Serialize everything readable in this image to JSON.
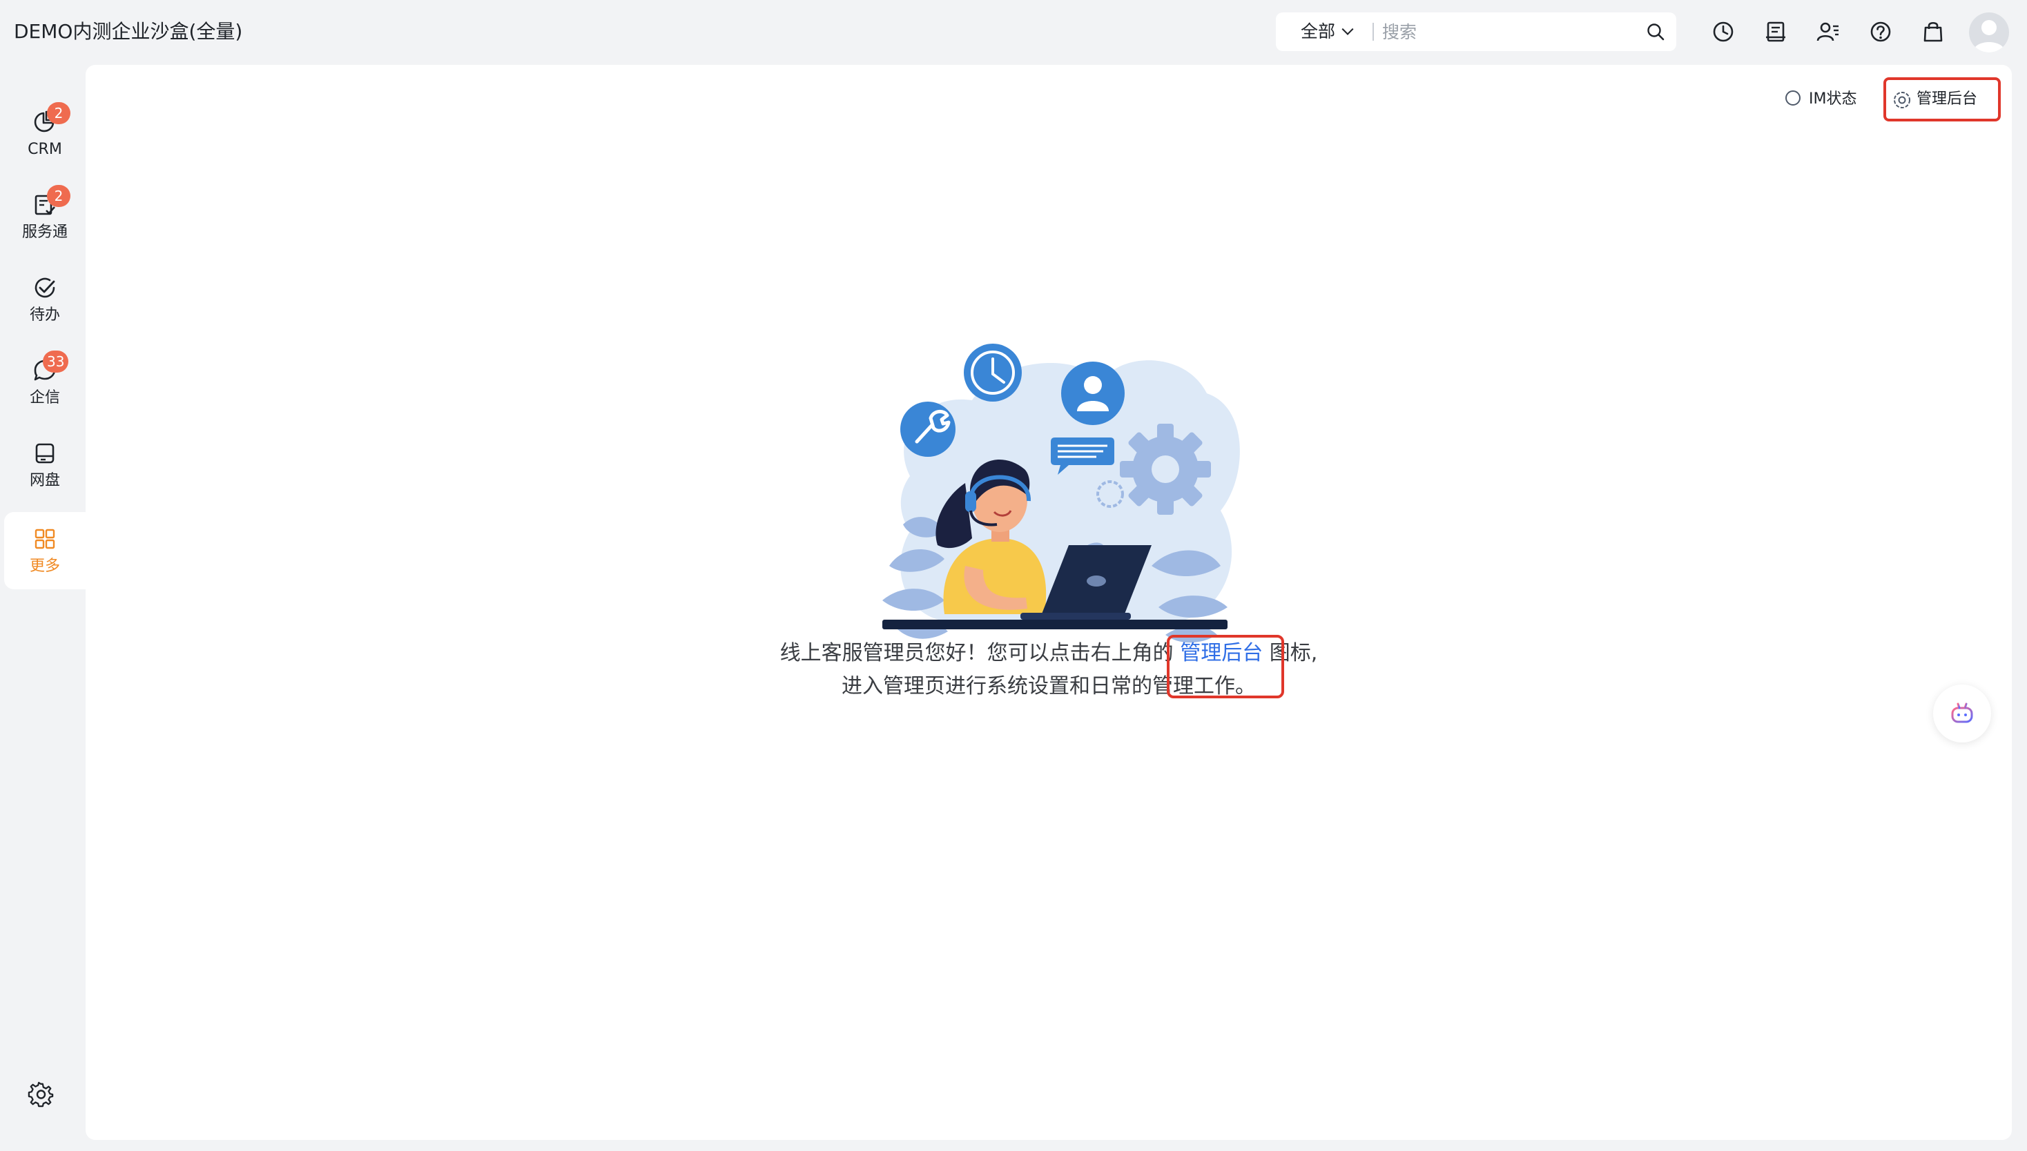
{
  "app": {
    "title": "DEMO内测企业沙盒(全量)"
  },
  "search": {
    "scope_label": "全部",
    "placeholder": "搜索",
    "value": ""
  },
  "top_icons": [
    "history-icon",
    "notebook-icon",
    "contacts-icon",
    "help-icon",
    "shopping-bag-icon",
    "user-avatar"
  ],
  "sidebar": {
    "items": [
      {
        "label": "CRM",
        "icon": "pie-chart-icon",
        "badge": "2",
        "active": false
      },
      {
        "label": "服务通",
        "icon": "service-clipboard-icon",
        "badge": "2",
        "active": false
      },
      {
        "label": "待办",
        "icon": "todo-check-icon",
        "badge": "",
        "active": false
      },
      {
        "label": "企信",
        "icon": "chat-bubble-icon",
        "badge": "33",
        "active": false
      },
      {
        "label": "网盘",
        "icon": "disk-drive-icon",
        "badge": "",
        "active": false
      },
      {
        "label": "更多",
        "icon": "grid-more-icon",
        "badge": "",
        "active": true
      }
    ],
    "settings_icon": "gear-icon"
  },
  "main": {
    "im_status_label": "IM状态",
    "admin_label": "管理后台",
    "message": {
      "line1_before": "线上客服管理员您好！您可以点击右上角的",
      "line1_link": "管理后台",
      "line1_after": "图标,",
      "line2": "进入管理页进行系统设置和日常的管理工作。"
    }
  },
  "colors": {
    "accent_orange": "#f08a24",
    "badge_red": "#ef6b4f",
    "link_blue": "#2f6ee6",
    "highlight_red": "#e0372b",
    "background": "#f2f3f5"
  }
}
